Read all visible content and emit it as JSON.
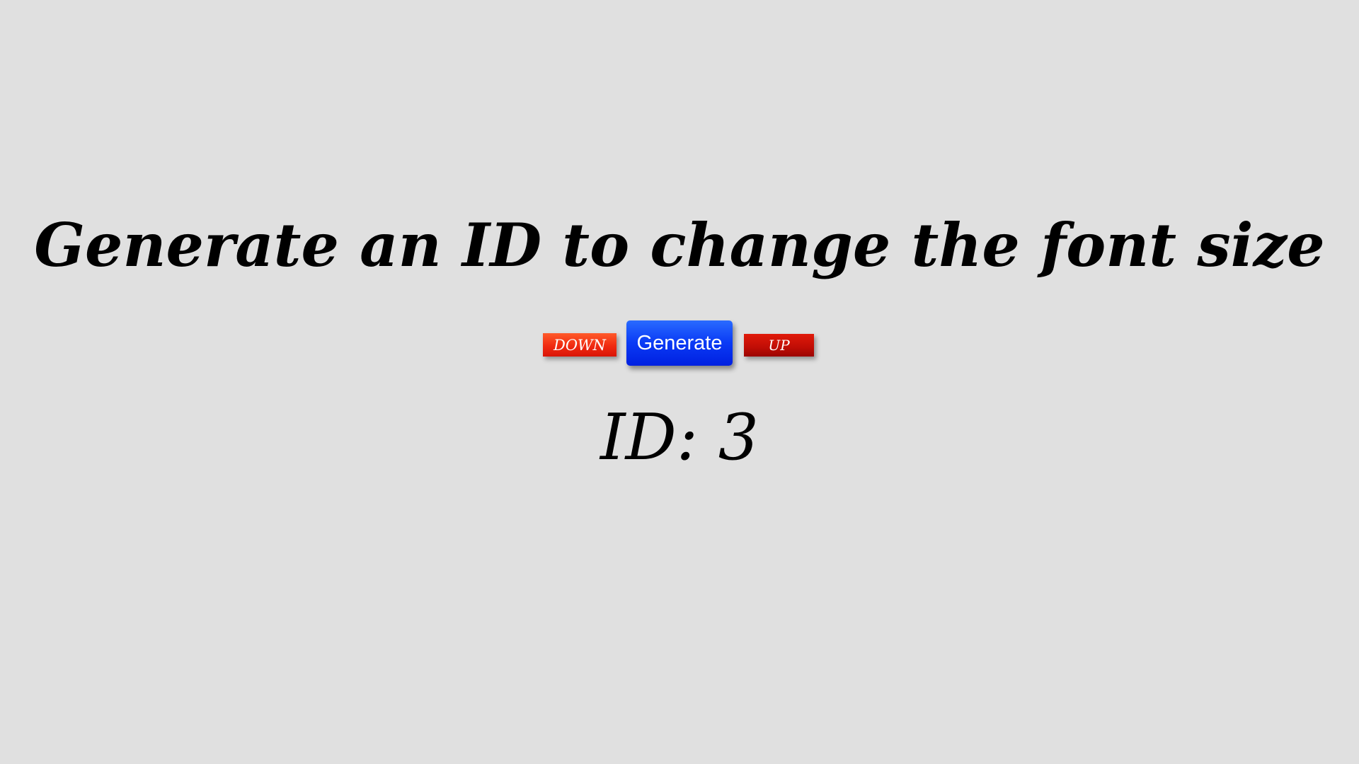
{
  "title": "Generate an ID to change the font size",
  "buttons": {
    "down_label": "DOWN",
    "generate_label": "Generate",
    "up_label": "UP"
  },
  "id_display": {
    "prefix": "ID:",
    "value": "3"
  },
  "colors": {
    "background": "#e0e0e0",
    "down_button": "#f02a10",
    "generate_button": "#0a3af5",
    "up_button": "#c00d05",
    "text": "#000000"
  }
}
